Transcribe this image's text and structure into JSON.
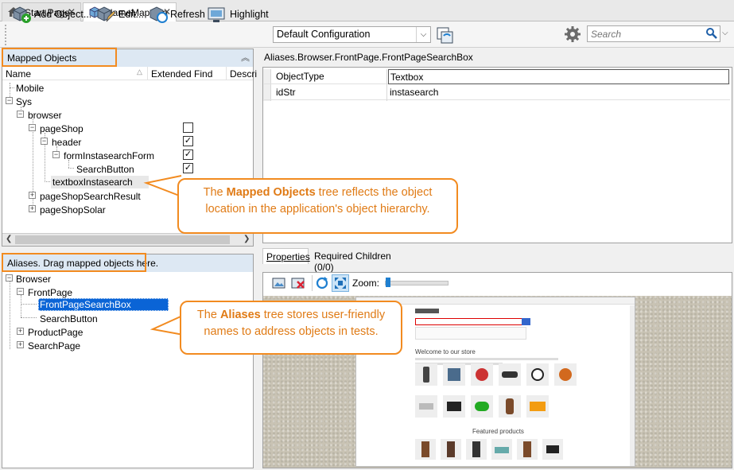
{
  "tabs": [
    {
      "label": "Start Page",
      "icon": "home-icon",
      "active": false
    },
    {
      "label": "NameMapping",
      "icon": "namemapping-icon",
      "active": true
    }
  ],
  "toolbar": {
    "add_object": "Add Object...",
    "edit": "Edit...",
    "refresh": "Refresh",
    "highlight": "Highlight",
    "configuration": "Default Configuration",
    "search_placeholder": "Search"
  },
  "mapped": {
    "title": "Mapped Objects",
    "columns": [
      "Name",
      "Extended Find",
      "Descri"
    ],
    "items": [
      {
        "label": "Mobile"
      },
      {
        "label": "Sys"
      },
      {
        "label": "browser"
      },
      {
        "label": "pageShop"
      },
      {
        "label": "header"
      },
      {
        "label": "formInstasearchForm"
      },
      {
        "label": "SearchButton"
      },
      {
        "label": "textboxInstasearch"
      },
      {
        "label": "pageShopSearchResult"
      },
      {
        "label": "pageShopSolar"
      }
    ]
  },
  "aliases": {
    "title": "Aliases. Drag mapped objects here.",
    "items": [
      {
        "label": "Browser"
      },
      {
        "label": "FrontPage"
      },
      {
        "label": "FrontPageSearchBox"
      },
      {
        "label": "SearchButton"
      },
      {
        "label": "ProductPage"
      },
      {
        "label": "SearchPage"
      }
    ]
  },
  "right": {
    "path": "Aliases.Browser.FrontPage.FrontPageSearchBox",
    "properties": [
      {
        "name": "ObjectType",
        "value": "Textbox"
      },
      {
        "name": "idStr",
        "value": "instasearch"
      }
    ],
    "tabs": [
      "Properties",
      "Required Children (0/0)"
    ],
    "zoom_label": "Zoom:"
  },
  "preview": {
    "welcome": "Welcome to our store",
    "featured": "Featured products"
  },
  "callouts": {
    "mapped_pre": "The ",
    "mapped_bold": "Mapped Objects",
    "mapped_post": " tree reflects the object location in the application's object hierarchy.",
    "aliases_pre": "The ",
    "aliases_bold": "Aliases",
    "aliases_post": " tree stores user-friendly names to address objects in tests."
  },
  "colors": {
    "accent": "#f28b20",
    "selection": "#0a64d6",
    "header_bg": "#dde8f3"
  }
}
